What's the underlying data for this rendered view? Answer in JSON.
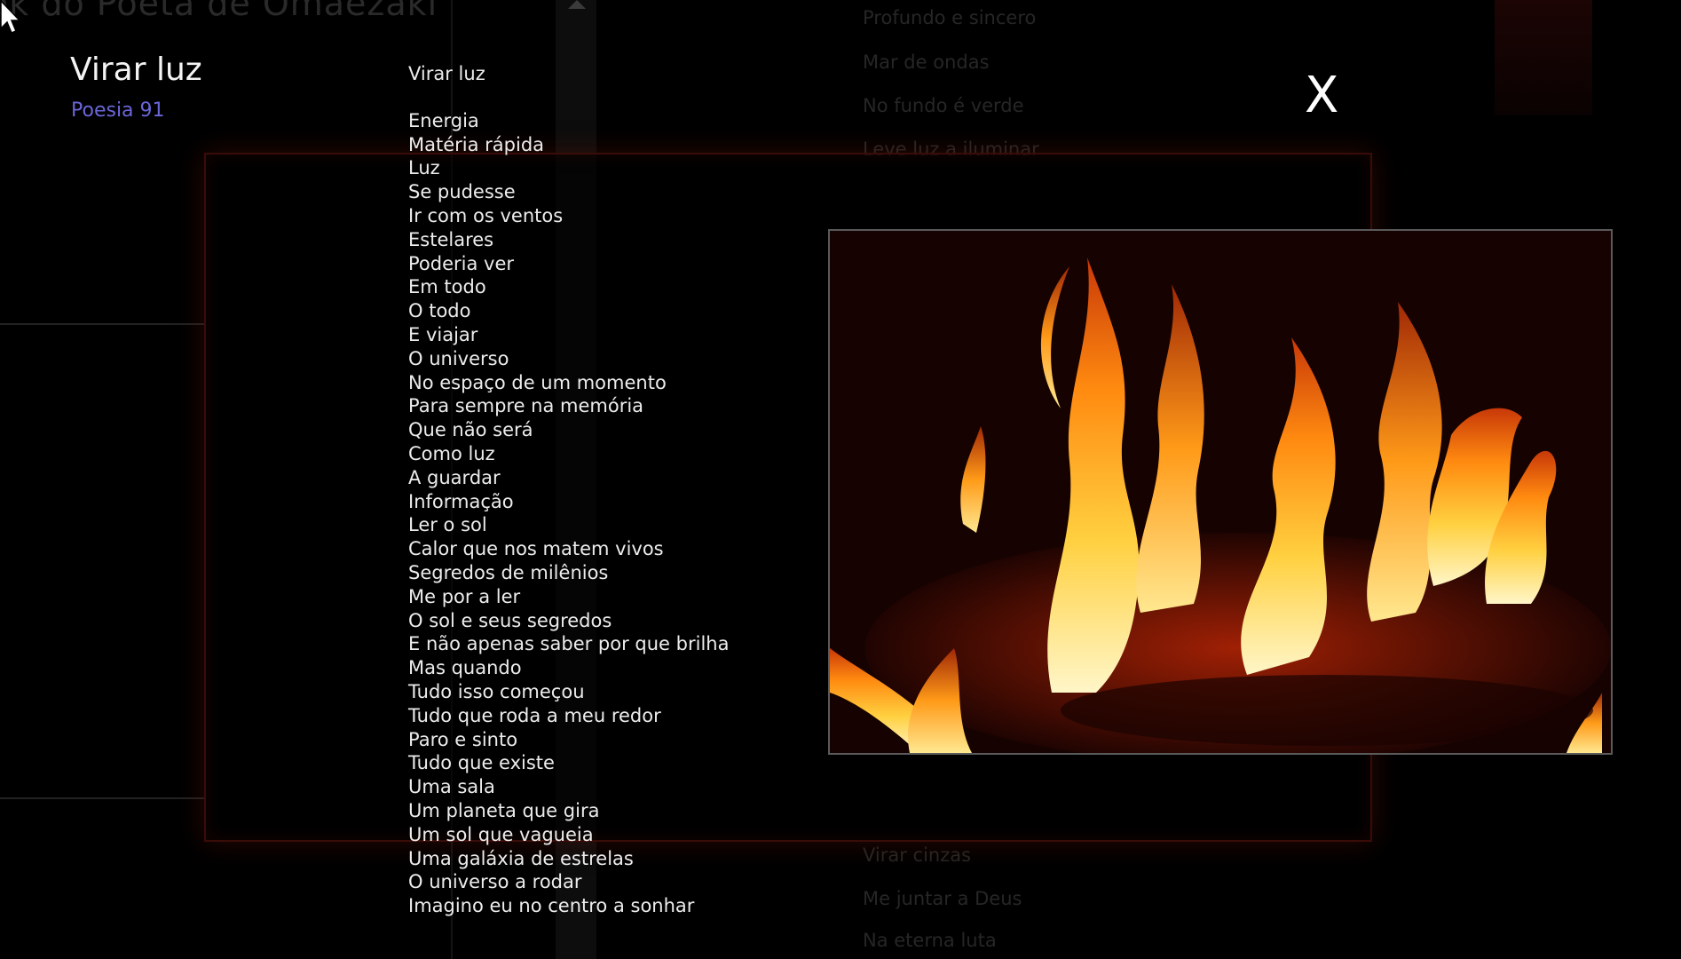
{
  "background": {
    "app_title": "ok do Poeta de Omaezaki",
    "menu_items_top": [
      "Profundo e sincero",
      "Mar de ondas",
      "No fundo é verde",
      "Leve luz a iluminar"
    ],
    "menu_items_bottom": [
      "Virar cinzas",
      "Me juntar a Deus",
      "Na eterna luta"
    ]
  },
  "poem": {
    "title": "Virar luz",
    "subtitle": "Poesia 91",
    "heading": "Virar luz",
    "lines": [
      "Energia",
      "Matéria rápida",
      "Luz",
      "Se pudesse",
      "Ir com os ventos",
      "Estelares",
      "Poderia ver",
      "Em todo",
      "O todo",
      "E viajar",
      "O universo",
      "No espaço de um momento",
      "Para sempre na memória",
      "Que não será",
      "Como luz",
      "A guardar",
      "Informação",
      "Ler o sol",
      "Calor que nos matem vivos",
      "Segredos de milênios",
      "Me por a ler",
      "O sol e seus segredos",
      "E não apenas saber por que brilha",
      "Mas quando",
      "Tudo isso começou",
      "Tudo que roda a meu redor",
      "Paro e sinto",
      "Tudo que existe",
      "Uma sala",
      "Um planeta que gira",
      "Um sol que vagueia",
      "Uma galáxia de estrelas",
      "O universo a rodar",
      "Imagino eu no centro a sonhar"
    ]
  },
  "close_label": "X",
  "colors": {
    "subtitle": "#6a66d8",
    "panel_border": "#3a0c08",
    "background": "#000000"
  }
}
